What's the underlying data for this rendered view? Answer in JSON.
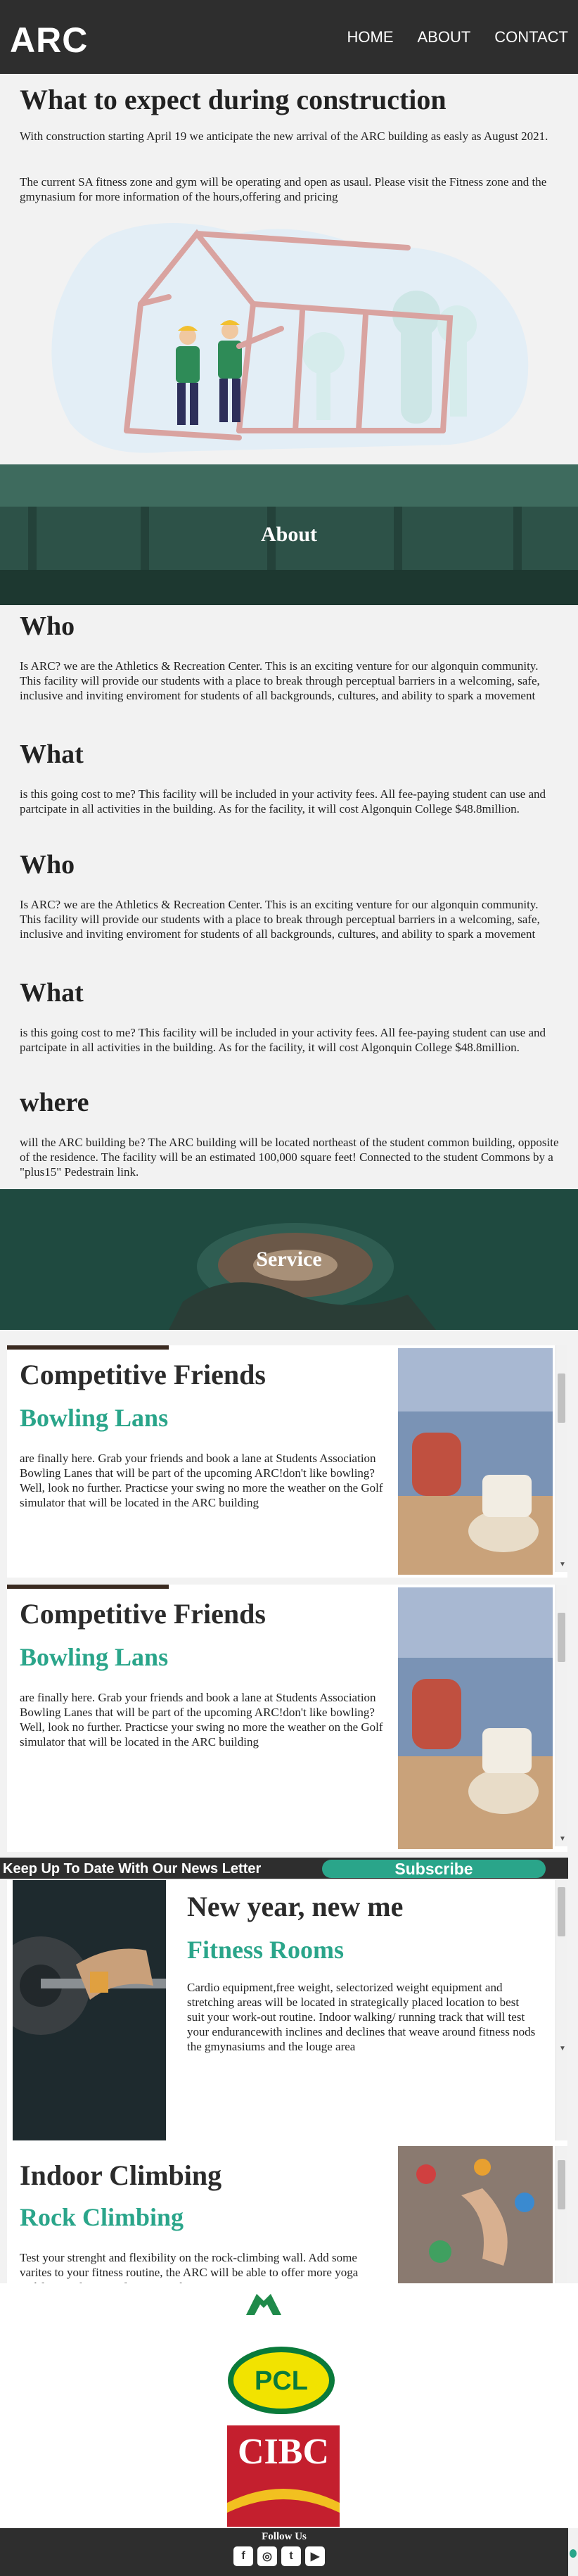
{
  "header": {
    "logo": "ARC",
    "nav": [
      "HOME",
      "ABOUT",
      "CONTACT"
    ]
  },
  "construction": {
    "title": "What to expect during construction",
    "p1": "With construction starting April 19 we anticipate the new arrival of the ARC building as easly as August 2021.",
    "p2": "The current SA fitness zone and gym will be operating and open as usaul. Please visit the Fitness zone and the gmynasium for more information of the hours,offering and pricing"
  },
  "about": {
    "banner": "About",
    "sections": [
      {
        "heading": "Who",
        "text": "Is ARC? we are the Athletics & Recreation Center. This is an exciting venture for our algonquin community. This facility will provide our students with a place to break through perceptual barriers in a welcoming, safe, inclusive and inviting enviroment for students of all backgrounds, cultures, and ability to spark a movement"
      },
      {
        "heading": "What",
        "text": "is this going cost to me? This facility will be included in your activity fees. All fee-paying student can use and partcipate in all activities in the building. As for the facility, it will cost Algonquin College $48.8million."
      },
      {
        "heading": "Who",
        "text": "Is ARC? we are the Athletics & Recreation Center. This is an exciting venture for our algonquin community. This facility will provide our students with a place to break through perceptual barriers in a welcoming, safe, inclusive and inviting enviroment for students of all backgrounds, cultures, and ability to spark a movement"
      },
      {
        "heading": "What",
        "text": "is this going cost to me? This facility will be included in your activity fees. All fee-paying student can use and partcipate in all activities in the building. As for the facility, it will cost Algonquin College $48.8million."
      },
      {
        "heading": "where",
        "text": "will the ARC building be? The ARC building will be located northeast of the student common building, opposite of the residence. The facility will be an estimated 100,000 square feet! Connected to the student Commons by a \"plus15\" Pedestrain link."
      }
    ]
  },
  "service": {
    "banner": "Service",
    "cards": [
      {
        "title": "Competitive Friends",
        "subtitle": "Bowling Lans",
        "text": "are finally here. Grab your friends and book a lane at Students Association Bowling Lanes that will be part of the upcoming ARC!don't like bowling?Well, look no further. Practicse your swing no more the weather on the Golf simulator that will be located in the ARC building"
      },
      {
        "title": "Competitive Friends",
        "subtitle": "Bowling Lans",
        "text": "are finally here. Grab your friends and book a lane at Students Association Bowling Lanes that will be part of the upcoming ARC!don't like bowling?Well, look no further. Practicse your swing no more the weather on the Golf simulator that will be located in the ARC building"
      },
      {
        "title": "New year, new me",
        "subtitle": "Fitness Rooms",
        "text": "Cardio equipment,free weight, selectorized weight equipment and stretching areas will be located in strategically placed location to best suit your work-out routine. Indoor walking/ running track that will test your endurancewith inclines and declines that weave around fitness nods the gmynasiums and the louge area"
      },
      {
        "title": "Indoor Climbing",
        "subtitle": "Rock Climbing",
        "text": "Test your strenght and flexibility on the rock-climbing wall. Add some varites to your fitness routine, the ARC will be able to offer more yoga and fitness classes to fit into yourbusy"
      }
    ]
  },
  "newsletter": {
    "text": "Keep Up To Date With Our News Letter",
    "button": "Subscribe"
  },
  "sponsors": [
    "PCL",
    "CIBC"
  ],
  "footer": {
    "follow": "Follow Us",
    "social": [
      "facebook-icon",
      "instagram-icon",
      "twitter-icon",
      "youtube-icon"
    ]
  },
  "colors": {
    "accent": "#2aa58a",
    "dark": "#2e2e2e",
    "banner": "#1f4a40"
  }
}
